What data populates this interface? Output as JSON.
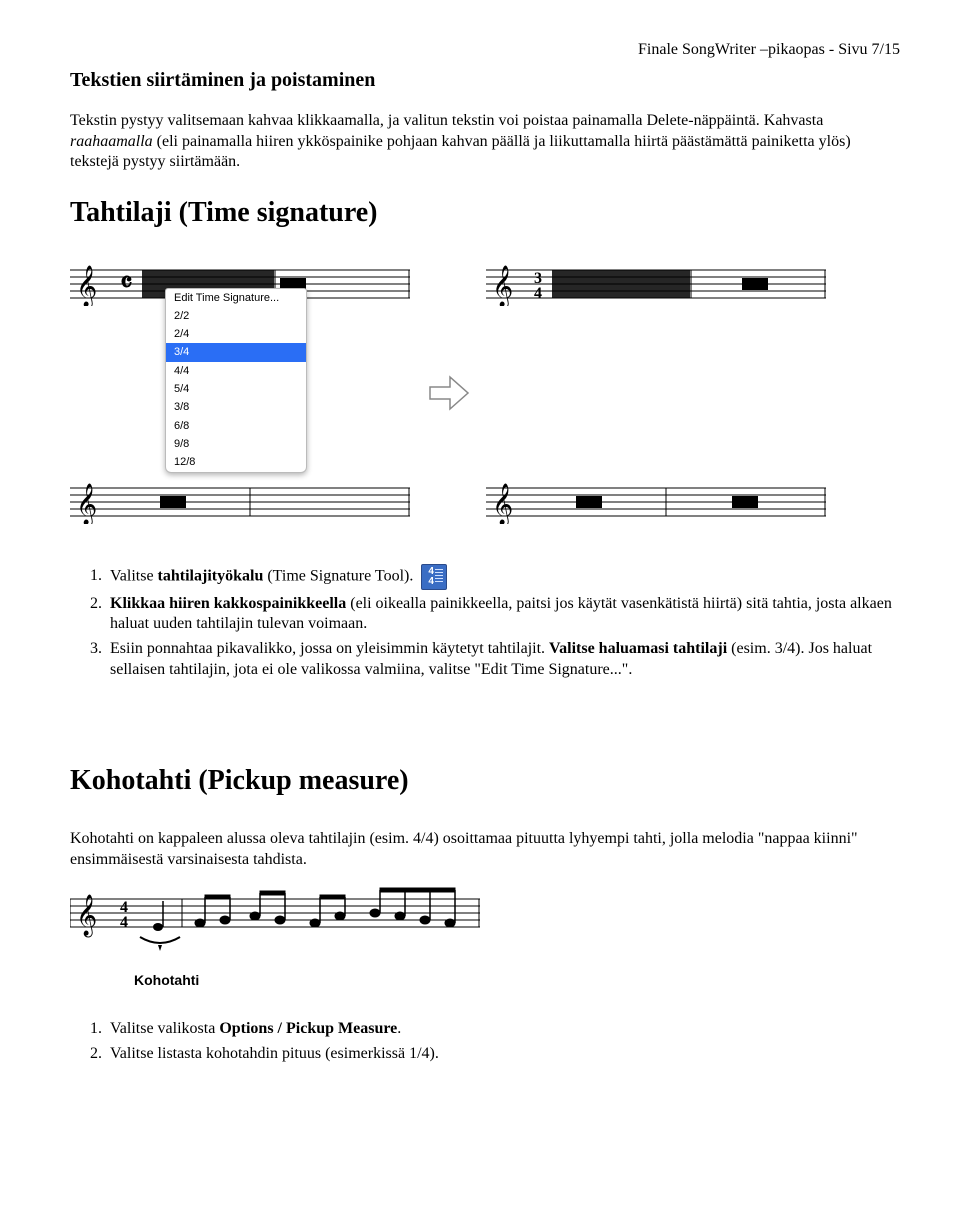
{
  "header": {
    "page_label": "Finale SongWriter –pikaopas - Sivu 7/15"
  },
  "section1": {
    "title": "Tekstien siirtäminen ja poistaminen",
    "para_plain_before": "Tekstin pystyy valitsemaan kahvaa klikkaamalla, ja valitun tekstin voi poistaa painamalla Delete-näppäintä. Kahvasta ",
    "para_italic": "raahaamalla",
    "para_plain_after": " (eli painamalla hiiren ykköspainike pohjaan kahvan päällä ja liikuttamalla hiirtä päästämättä painiketta ylös) tekstejä pystyy siirtämään."
  },
  "section2": {
    "title": "Tahtilaji (Time signature)",
    "menu": {
      "edit_label": "Edit Time Signature...",
      "items": [
        "2/2",
        "2/4",
        "3/4",
        "4/4",
        "5/4",
        "3/8",
        "6/8",
        "9/8",
        "12/8"
      ],
      "selected": "3/4"
    },
    "right_timesig_top": "3",
    "right_timesig_bottom": "4",
    "list": {
      "i1_before": "Valitse ",
      "i1_bold": "tahtilajityökalu",
      "i1_after": " (Time Signature Tool). ",
      "i2_bold": "Klikkaa hiiren kakkospainikkeella",
      "i2_after": " (eli oikealla painikkeella, paitsi jos käytät vasenkätistä hiirtä) sitä tahtia, josta alkaen haluat uuden tahtilajin tulevan voimaan.",
      "i3_a": "Esiin ponnahtaa pikavalikko, jossa on yleisimmin käytetyt tahtilajit. ",
      "i3_bold1": "Valitse haluamasi tahtilaji",
      "i3_b": " (esim. 3/4). Jos haluat sellaisen tahtilajin, jota ei ole valikossa valmiina, valitse \"Edit Time Signature...\"."
    },
    "tool_icon": {
      "top": "4",
      "bottom": "4"
    }
  },
  "section3": {
    "title": "Kohotahti (Pickup measure)",
    "para": "Kohotahti on kappaleen alussa oleva tahtilajin (esim. 4/4) osoittamaa pituutta lyhyempi tahti, jolla melodia \"nappaa kiinni\" ensimmäisestä varsinaisesta tahdista.",
    "fig_timesig_top": "4",
    "fig_timesig_bottom": "4",
    "fig_label": "Kohotahti",
    "list": {
      "i1_before": "Valitse valikosta ",
      "i1_bold": "Options / Pickup Measure",
      "i1_after": ".",
      "i2": "Valitse listasta kohotahdin pituus (esimerkissä 1/4)."
    }
  }
}
